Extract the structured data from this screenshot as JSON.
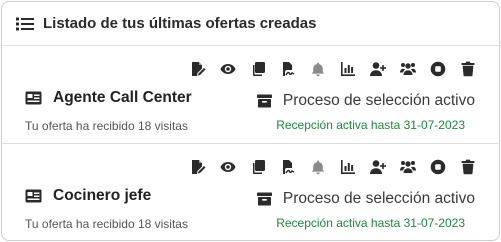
{
  "colors": {
    "icon": "#2b2b2b",
    "icon_muted": "#8a8a8a",
    "reception_green": "#1a8a3a",
    "border": "#cfcfcf"
  },
  "header": {
    "icon": "list-icon",
    "title": "Listado de tus últimas ofertas creadas"
  },
  "action_icons": [
    "edit-document-icon",
    "eye-icon",
    "copy-icon",
    "file-signature-icon",
    "bell-icon",
    "bar-chart-icon",
    "user-plus-icon",
    "users-icon",
    "stop-circle-icon",
    "trash-icon"
  ],
  "offers": [
    {
      "title": "Agente Call Center",
      "visits": "Tu oferta ha recibido 18 visitas",
      "status": "Proceso de selección activo",
      "reception": "Recepción activa hasta 31-07-2023"
    },
    {
      "title": "Cocinero jefe",
      "visits": "Tu oferta ha recibido 18 visitas",
      "status": "Proceso de selección activo",
      "reception": "Recepción activa hasta 31-07-2023"
    }
  ]
}
